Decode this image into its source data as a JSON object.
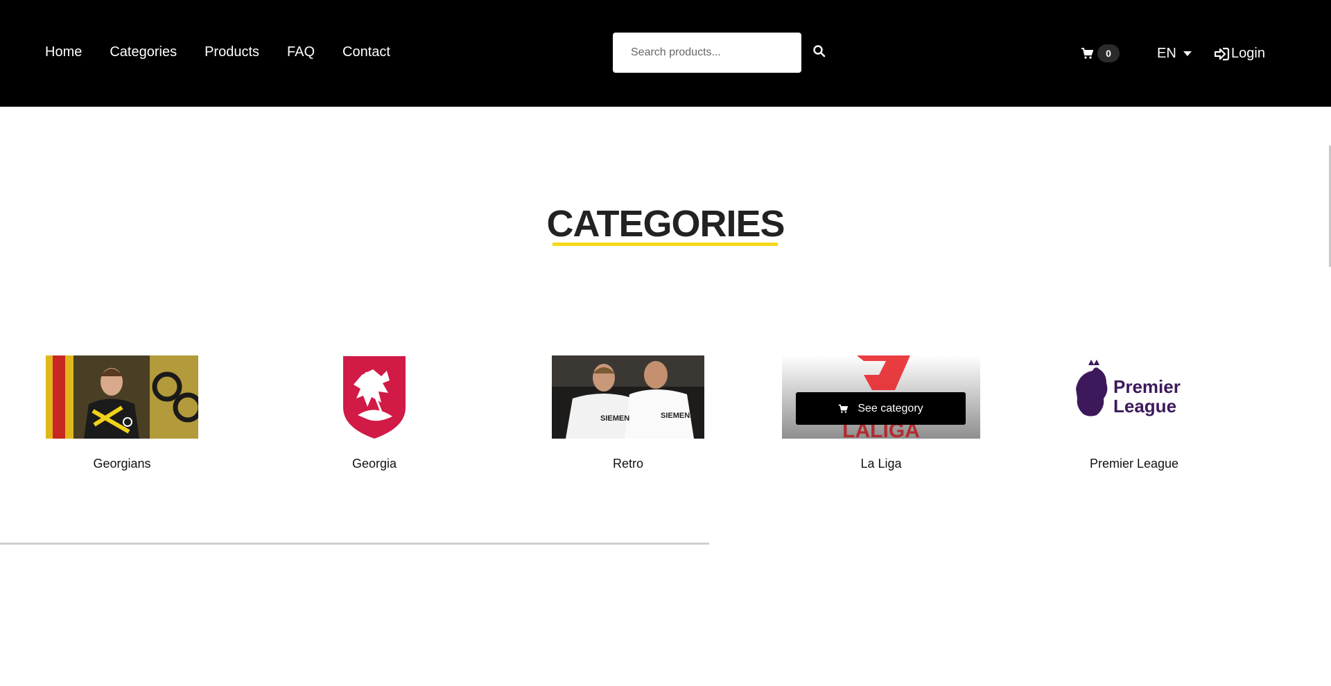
{
  "nav": {
    "items": [
      {
        "label": "Home"
      },
      {
        "label": "Categories"
      },
      {
        "label": "Products"
      },
      {
        "label": "FAQ"
      },
      {
        "label": "Contact"
      }
    ]
  },
  "search": {
    "placeholder": "Search products..."
  },
  "cart": {
    "count": "0",
    "icon": "cart-icon"
  },
  "language": {
    "current": "EN"
  },
  "login": {
    "label": "Login",
    "icon": "login-icon"
  },
  "page": {
    "title": "CATEGORIES",
    "accent_color": "#f7d81b"
  },
  "categories": [
    {
      "label": "Georgians"
    },
    {
      "label": "Georgia"
    },
    {
      "label": "Retro"
    },
    {
      "label": "La Liga",
      "hover_button": "See category",
      "wordmark": "LALIGA"
    },
    {
      "label": "Premier League",
      "wordmark_line1": "Premier",
      "wordmark_line2": "League"
    }
  ],
  "colors": {
    "header_bg": "#000000",
    "georgia_red": "#d11a46",
    "premier_purple": "#3d195b",
    "laliga_red": "#e8282d"
  }
}
